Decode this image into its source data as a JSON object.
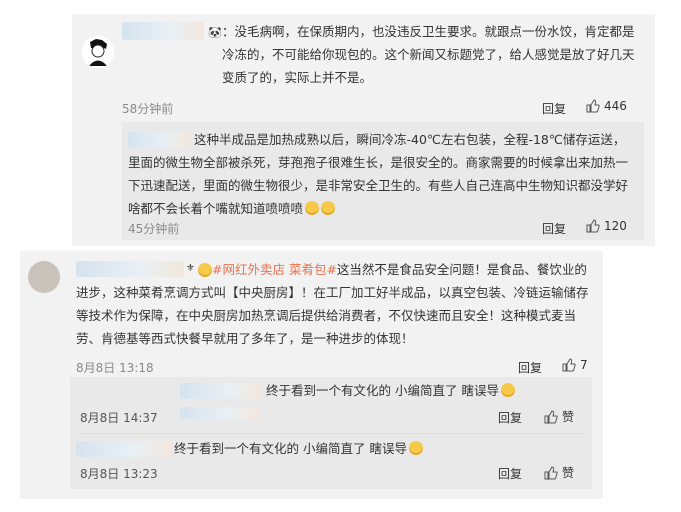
{
  "top_comment": {
    "text": "：没毛病啊，在保质期内，也没违反卫生要求。就跟点一份水饺，肯定都是冷冻的，不可能给你现包的。这个新闻又标题党了，给人感觉是放了好几天变质了的，实际上并不是。",
    "time": "58分钟前",
    "reply_label": "回复",
    "likes": "446"
  },
  "top_reply": {
    "text": "这种半成品是加热成熟以后，瞬间冷冻-40℃左右包装，全程-18℃储存运送，里面的微生物全部被杀死，芽孢孢子很难生长，是很安全的。商家需要的时候拿出来加热一下迅速配送，里面的微生物很少，是非常安全卫生的。有些人自己连高中生物知识都没学好啥都不会长着个嘴就知道喷喷喷",
    "time": "45分钟前",
    "reply_label": "回复",
    "likes": "120"
  },
  "bottom_comment": {
    "tag": "#网红外卖店 菜肴包#",
    "text": "这当然不是食品安全问题！是食品、餐饮业的进步，这种菜肴烹调方式叫【中央厨房】！在工厂加工好半成品，以真空包装、冷链运输储存等技术作为保障，在中央厨房加热烹调后提供给消费者，不仅快速而且安全！这种模式麦当劳、肯德基等西式快餐早就用了多年了，是一种进步的体现！",
    "time": "8月8日 13:18",
    "reply_label": "回复",
    "likes": "7"
  },
  "bottom_replies": [
    {
      "text": "终于看到一个有文化的 小编简直了 瞎误导",
      "time": "8月8日 14:37",
      "reply_label": "回复",
      "like_label": "赞"
    },
    {
      "text": "终于看到一个有文化的 小编简直了 瞎误导",
      "time": "8月8日 13:23",
      "reply_label": "回复",
      "like_label": "赞"
    }
  ],
  "colors": {
    "panel": "#f2f2f2",
    "reply_bg": "#e9e9e9",
    "tag": "#eb7350",
    "muted": "#8a8a8a"
  }
}
